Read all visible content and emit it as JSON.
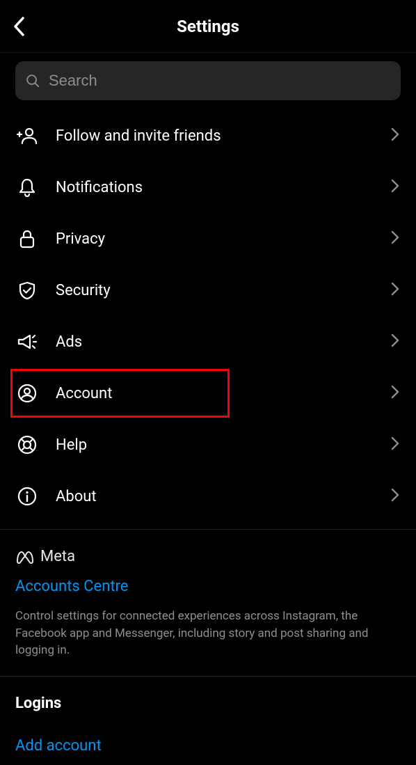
{
  "header": {
    "title": "Settings"
  },
  "search": {
    "placeholder": "Search"
  },
  "menu": {
    "items": [
      {
        "label": "Follow and invite friends",
        "icon": "add-person-icon",
        "highlight": false
      },
      {
        "label": "Notifications",
        "icon": "bell-icon",
        "highlight": false
      },
      {
        "label": "Privacy",
        "icon": "lock-icon",
        "highlight": false
      },
      {
        "label": "Security",
        "icon": "shield-icon",
        "highlight": false
      },
      {
        "label": "Ads",
        "icon": "megaphone-icon",
        "highlight": false
      },
      {
        "label": "Account",
        "icon": "user-circle-icon",
        "highlight": true
      },
      {
        "label": "Help",
        "icon": "lifebuoy-icon",
        "highlight": false
      },
      {
        "label": "About",
        "icon": "info-icon",
        "highlight": false
      }
    ]
  },
  "meta": {
    "brand": "Meta",
    "link_label": "Accounts Centre",
    "description": "Control settings for connected experiences across Instagram, the Facebook app and Messenger, including story and post sharing and logging in."
  },
  "logins": {
    "title": "Logins",
    "add_account_label": "Add account"
  }
}
